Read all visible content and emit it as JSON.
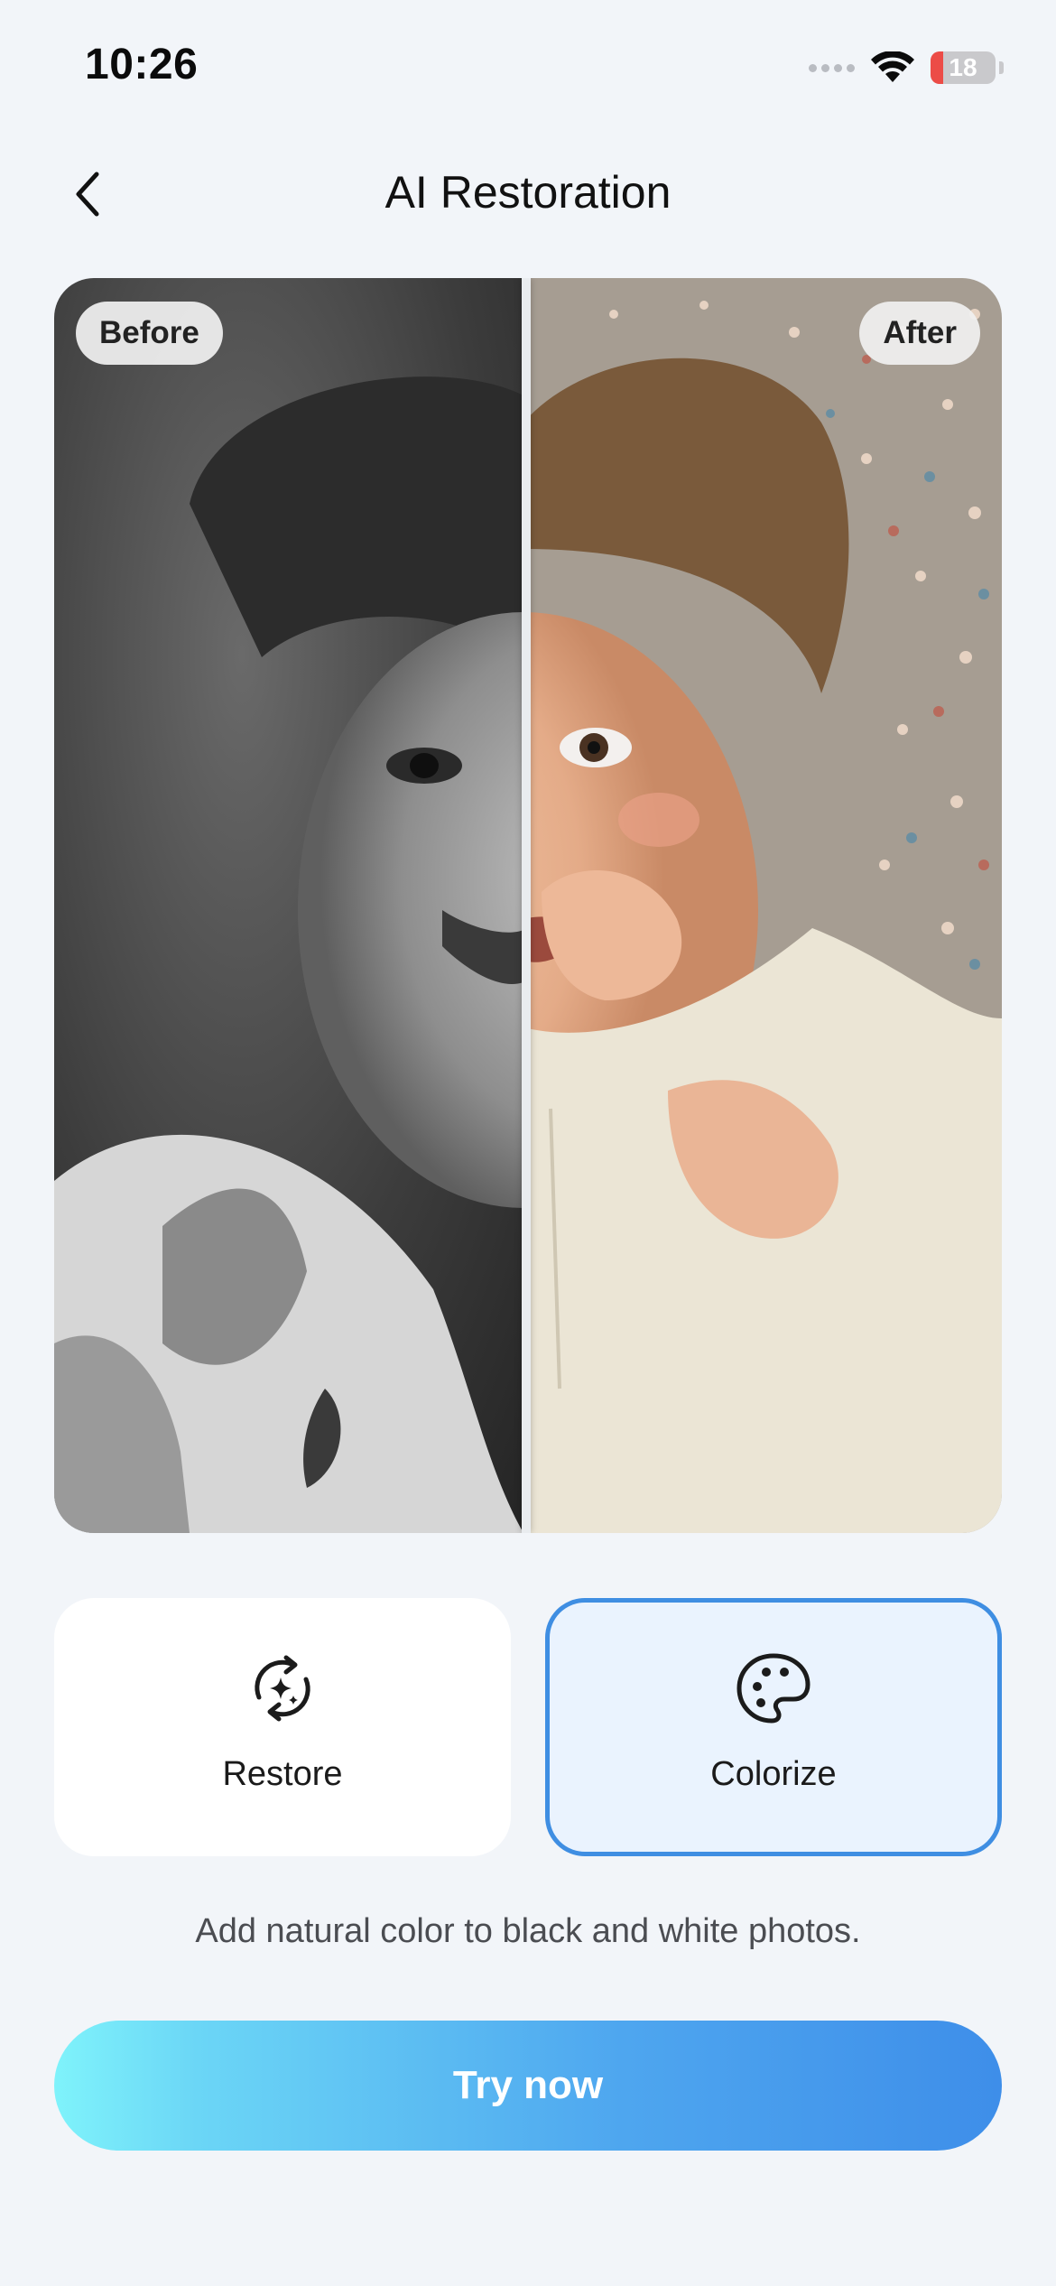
{
  "status_bar": {
    "time": "10:26",
    "battery_level": "18"
  },
  "nav": {
    "title": "AI Restoration",
    "back_icon": "chevron-left-icon"
  },
  "compare": {
    "before_label": "Before",
    "after_label": "After"
  },
  "modes": [
    {
      "label": "Restore",
      "icon": "sparkle-refresh-icon",
      "selected": false
    },
    {
      "label": "Colorize",
      "icon": "palette-icon",
      "selected": true
    }
  ],
  "description": "Add natural color to black and white photos.",
  "cta": {
    "label": "Try now"
  },
  "colors": {
    "accent": "#3f8ee2",
    "selected_bg": "#eaf3fe",
    "gradient_start": "#7ff3fb",
    "gradient_end": "#3e8ee9"
  }
}
